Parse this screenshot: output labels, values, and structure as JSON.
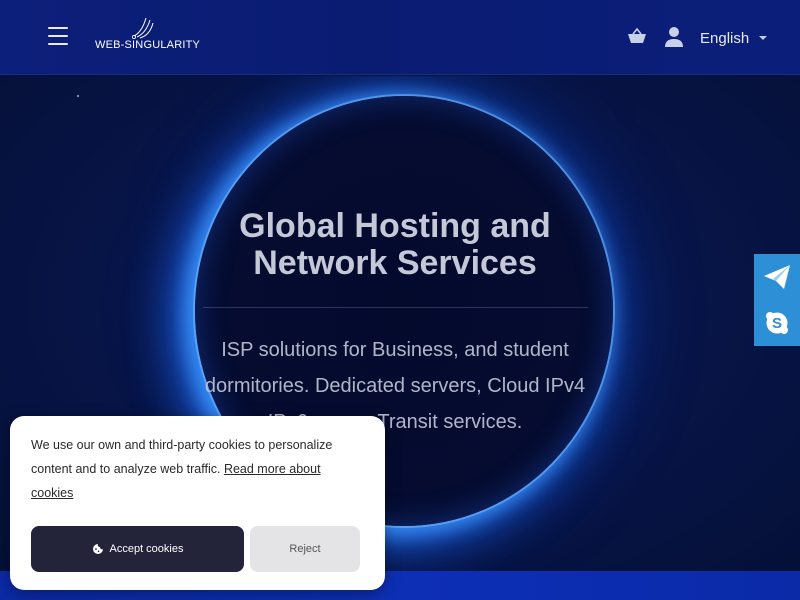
{
  "header": {
    "menu_icon": "hamburger-icon",
    "logo_text": "WEB-SINGULARITY",
    "cart_icon": "basket-icon",
    "user_icon": "user-icon",
    "language": "English"
  },
  "hero": {
    "title_line1": "Global Hosting and",
    "title_line2": "Network Services",
    "subtitle": "ISP solutions for Business, and student dormitories. Dedicated servers, Cloud IPv4 IPv6 space. Transit services."
  },
  "side_widget": {
    "telegram_icon": "telegram-icon",
    "skype_icon": "skype-icon"
  },
  "cookie_banner": {
    "text": "We use our own and third-party cookies to personalize content and to analyze web traffic. ",
    "link_text": "Read more about cookies",
    "accept_label": "Accept cookies",
    "reject_label": "Reject",
    "accept_icon": "cookie-icon"
  },
  "colors": {
    "header_bg": "#0c1f7a",
    "hero_bg": "#071446",
    "glow": "#3c96ff",
    "side_widget": "#2d8fd6",
    "accept_bg": "#232339",
    "reject_bg": "#e4e4e6"
  }
}
